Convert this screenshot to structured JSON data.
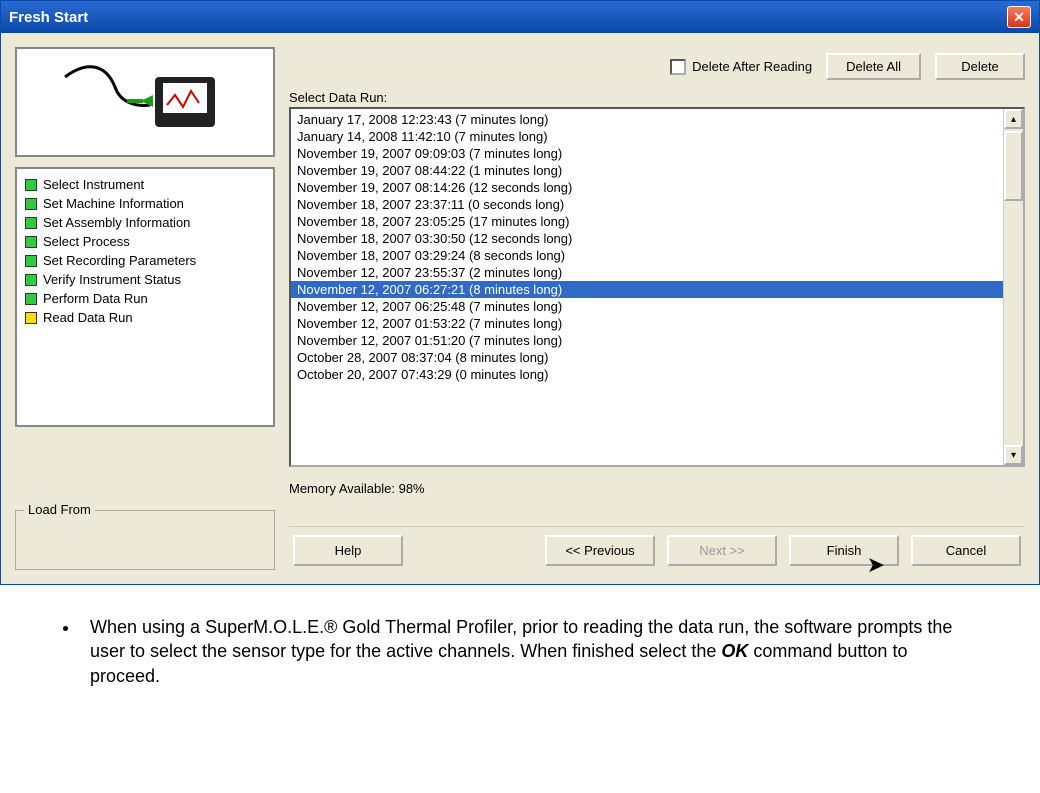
{
  "window": {
    "title": "Fresh Start"
  },
  "steps": [
    {
      "color": "green",
      "label": "Select Instrument"
    },
    {
      "color": "green",
      "label": "Set Machine Information"
    },
    {
      "color": "green",
      "label": "Set Assembly Information"
    },
    {
      "color": "green",
      "label": "Select Process"
    },
    {
      "color": "green",
      "label": "Set Recording Parameters"
    },
    {
      "color": "green",
      "label": "Verify Instrument Status"
    },
    {
      "color": "green",
      "label": "Perform Data Run"
    },
    {
      "color": "yellow",
      "label": "Read Data Run"
    }
  ],
  "load_from_label": "Load From",
  "top": {
    "delete_after_reading": "Delete After Reading",
    "delete_all": "Delete All",
    "delete": "Delete"
  },
  "select_label": "Select Data Run:",
  "runs": [
    {
      "text": "January 17, 2008    12:23:43 (7 minutes long)",
      "selected": false
    },
    {
      "text": "January 14, 2008    11:42:10 (7 minutes long)",
      "selected": false
    },
    {
      "text": "November 19, 2007    09:09:03 (7 minutes long)",
      "selected": false
    },
    {
      "text": "November 19, 2007    08:44:22 (1 minutes long)",
      "selected": false
    },
    {
      "text": "November 19, 2007    08:14:26 (12 seconds long)",
      "selected": false
    },
    {
      "text": "November 18, 2007    23:37:11 (0 seconds long)",
      "selected": false
    },
    {
      "text": "November 18, 2007    23:05:25 (17 minutes long)",
      "selected": false
    },
    {
      "text": "November 18, 2007    03:30:50 (12 seconds long)",
      "selected": false
    },
    {
      "text": "November 18, 2007    03:29:24 (8 seconds long)",
      "selected": false
    },
    {
      "text": "November 12, 2007    23:55:37 (2 minutes long)",
      "selected": false
    },
    {
      "text": "November 12, 2007    06:27:21 (8 minutes long)",
      "selected": true
    },
    {
      "text": "November 12, 2007    06:25:48 (7 minutes long)",
      "selected": false
    },
    {
      "text": "November 12, 2007    01:53:22 (7 minutes long)",
      "selected": false
    },
    {
      "text": "November 12, 2007    01:51:20 (7 minutes long)",
      "selected": false
    },
    {
      "text": "October 28, 2007    08:37:04 (8 minutes long)",
      "selected": false
    },
    {
      "text": "October 20, 2007    07:43:29 (0 minutes long)",
      "selected": false
    }
  ],
  "memory_label": "Memory Available: 98%",
  "buttons": {
    "help": "Help",
    "previous": "<< Previous",
    "next": "Next >>",
    "finish": "Finish",
    "cancel": "Cancel"
  },
  "doc": {
    "bullet_pre": "When using a SuperM.O.L.E.® Gold Thermal Profiler, prior to reading the data run, the software prompts the user to select the sensor type for the active channels. When finished select the ",
    "bullet_bold": "OK",
    "bullet_post": " command button to proceed."
  }
}
